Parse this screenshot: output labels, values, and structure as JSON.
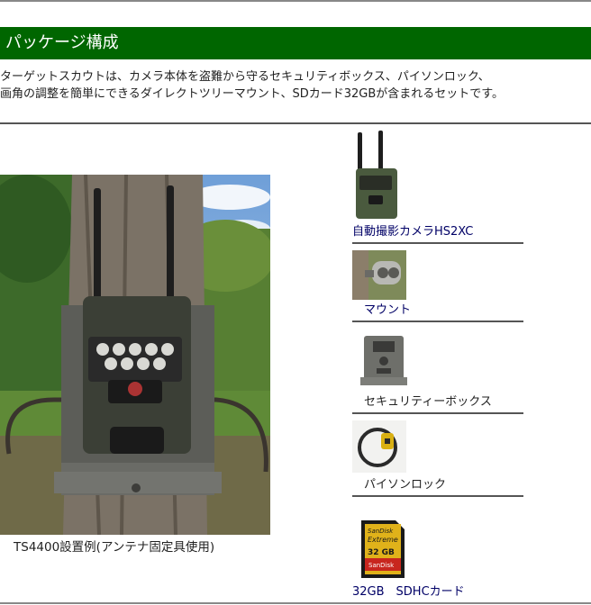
{
  "section": {
    "title": "パッケージ構成",
    "intro_line1": "ターゲットスカウトは、カメラ本体を盗難から守るセキュリティボックス、パイソンロック、",
    "intro_line2": "画角の調整を簡単にできるダイレクトツリーマウント、SDカード32GBが含まれるセットです。"
  },
  "photo": {
    "caption": "TS4400設置例(アンテナ固定具使用)"
  },
  "items": [
    {
      "label": "自動撮影カメラHS2XC",
      "icon": "camera-icon"
    },
    {
      "label": "マウント",
      "icon": "mount-icon"
    },
    {
      "label": "セキュリティーボックス",
      "icon": "security-box-icon"
    },
    {
      "label": "パイソンロック",
      "icon": "python-lock-icon"
    },
    {
      "label": "32GB　SDHCカード",
      "icon": "sd-card-icon"
    }
  ],
  "sdcard": {
    "brand_top": "SanDisk",
    "series": "Extreme",
    "capacity": "32 GB",
    "brand_bottom": "SanDisk"
  },
  "colors": {
    "banner": "#006600",
    "link_blue": "#000066"
  }
}
